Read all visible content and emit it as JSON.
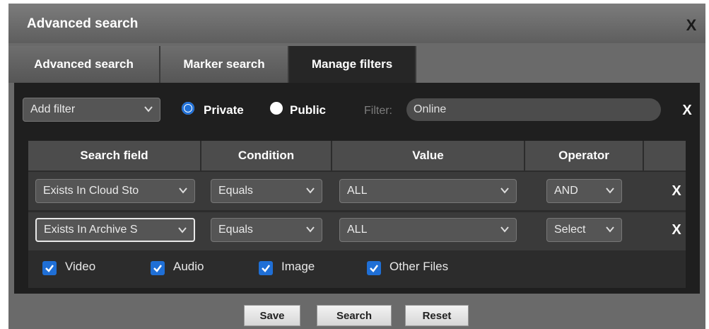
{
  "dialog": {
    "title": "Advanced search",
    "close_label": "X"
  },
  "tabs": [
    {
      "label": "Advanced search",
      "active": false
    },
    {
      "label": "Marker search",
      "active": false
    },
    {
      "label": "Manage filters",
      "active": true
    }
  ],
  "filter_bar": {
    "add_filter_value": "Add filter",
    "visibility_options": [
      {
        "label": "Private",
        "checked": true
      },
      {
        "label": "Public",
        "checked": false
      }
    ],
    "filter_label": "Filter:",
    "filter_value": "Online",
    "clear_label": "X"
  },
  "table": {
    "headers": [
      "Search field",
      "Condition",
      "Value",
      "Operator",
      ""
    ],
    "rows": [
      {
        "search_field": "Exists In Cloud Sto",
        "condition": "Equals",
        "value": "ALL",
        "operator": "AND",
        "delete_label": "X"
      },
      {
        "search_field": "Exists In Archive S",
        "condition": "Equals",
        "value": "ALL",
        "operator": "Select",
        "delete_label": "X"
      }
    ]
  },
  "file_types": [
    {
      "label": "Video",
      "checked": true
    },
    {
      "label": "Audio",
      "checked": true
    },
    {
      "label": "Image",
      "checked": true
    },
    {
      "label": "Other Files",
      "checked": true
    }
  ],
  "buttons": {
    "save": "Save",
    "search": "Search",
    "reset": "Reset"
  },
  "colors": {
    "accent": "#1f6fd6",
    "panel": "#1f1f1f",
    "frame": "#6a6a6a"
  }
}
